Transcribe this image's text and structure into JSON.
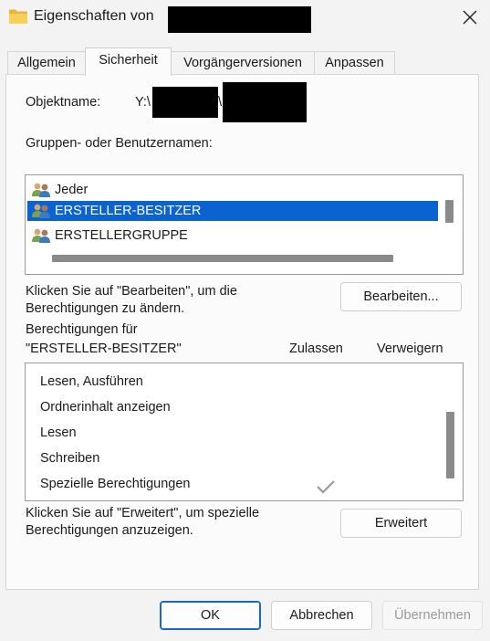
{
  "window": {
    "title": "Eigenschaften von",
    "close_icon": "close-icon"
  },
  "tabs": [
    {
      "label": "Allgemein",
      "active": false
    },
    {
      "label": "Sicherheit",
      "active": true
    },
    {
      "label": "Vorgängerversionen",
      "active": false
    },
    {
      "label": "Anpassen",
      "active": false
    }
  ],
  "object": {
    "label": "Objektname:",
    "value_prefix": "Y:\\",
    "separator": "\\"
  },
  "groups": {
    "label": "Gruppen- oder Benutzernamen:",
    "items": [
      {
        "name": "Jeder",
        "icon": "users-icon",
        "selected": false
      },
      {
        "name": "ERSTELLER-BESITZER",
        "icon": "users-icon",
        "selected": true
      },
      {
        "name": "ERSTELLERGRUPPE",
        "icon": "users-icon",
        "selected": false
      }
    ]
  },
  "edit": {
    "hint": "Klicken Sie auf \"Bearbeiten\", um die Berechtigungen zu ändern.",
    "hint_line1": "Klicken Sie auf \"Bearbeiten\", um die",
    "hint_line2": "Berechtigungen zu ändern.",
    "button": "Bearbeiten..."
  },
  "permissions": {
    "for_label_line1": "Berechtigungen für",
    "for_label_line2": "\"ERSTELLER-BESITZER\"",
    "col_allow": "Zulassen",
    "col_deny": "Verweigern",
    "rows": [
      {
        "name": "Lesen, Ausführen",
        "allow": false,
        "deny": false
      },
      {
        "name": "Ordnerinhalt anzeigen",
        "allow": false,
        "deny": false
      },
      {
        "name": "Lesen",
        "allow": false,
        "deny": false
      },
      {
        "name": "Schreiben",
        "allow": false,
        "deny": false
      },
      {
        "name": "Spezielle Berechtigungen",
        "allow": true,
        "deny": false
      }
    ]
  },
  "advanced": {
    "hint_line1": "Klicken Sie auf \"Erweitert\", um spezielle",
    "hint_line2": "Berechtigungen anzuzeigen.",
    "button": "Erweitert"
  },
  "footer": {
    "ok": "OK",
    "cancel": "Abbrechen",
    "apply": "Übernehmen"
  },
  "colors": {
    "selection": "#0a63d0",
    "primary_border": "#1667c7",
    "background": "#f3f3f3"
  }
}
